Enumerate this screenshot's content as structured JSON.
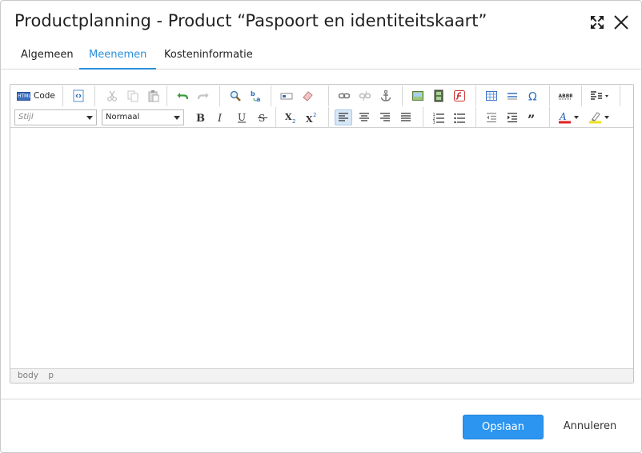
{
  "dialog": {
    "title": "Productplanning - Product “Paspoort en identiteitskaart”"
  },
  "tabs": [
    {
      "label": "Algemeen",
      "active": false
    },
    {
      "label": "Meenemen",
      "active": true
    },
    {
      "label": "Kosteninformatie",
      "active": false
    }
  ],
  "editor": {
    "toolbar": {
      "code_label": "Code",
      "style_placeholder": "Stijl",
      "format_value": "Normaal"
    },
    "content": "",
    "statusbar": {
      "path": [
        "body",
        "p"
      ]
    }
  },
  "footer": {
    "save_label": "Opslaan",
    "cancel_label": "Annuleren"
  },
  "colors": {
    "accent": "#2b8fdb",
    "primary_button": "#2b95f0",
    "font_color_bar": "#e02020",
    "highlight_bar": "#f0e020"
  }
}
